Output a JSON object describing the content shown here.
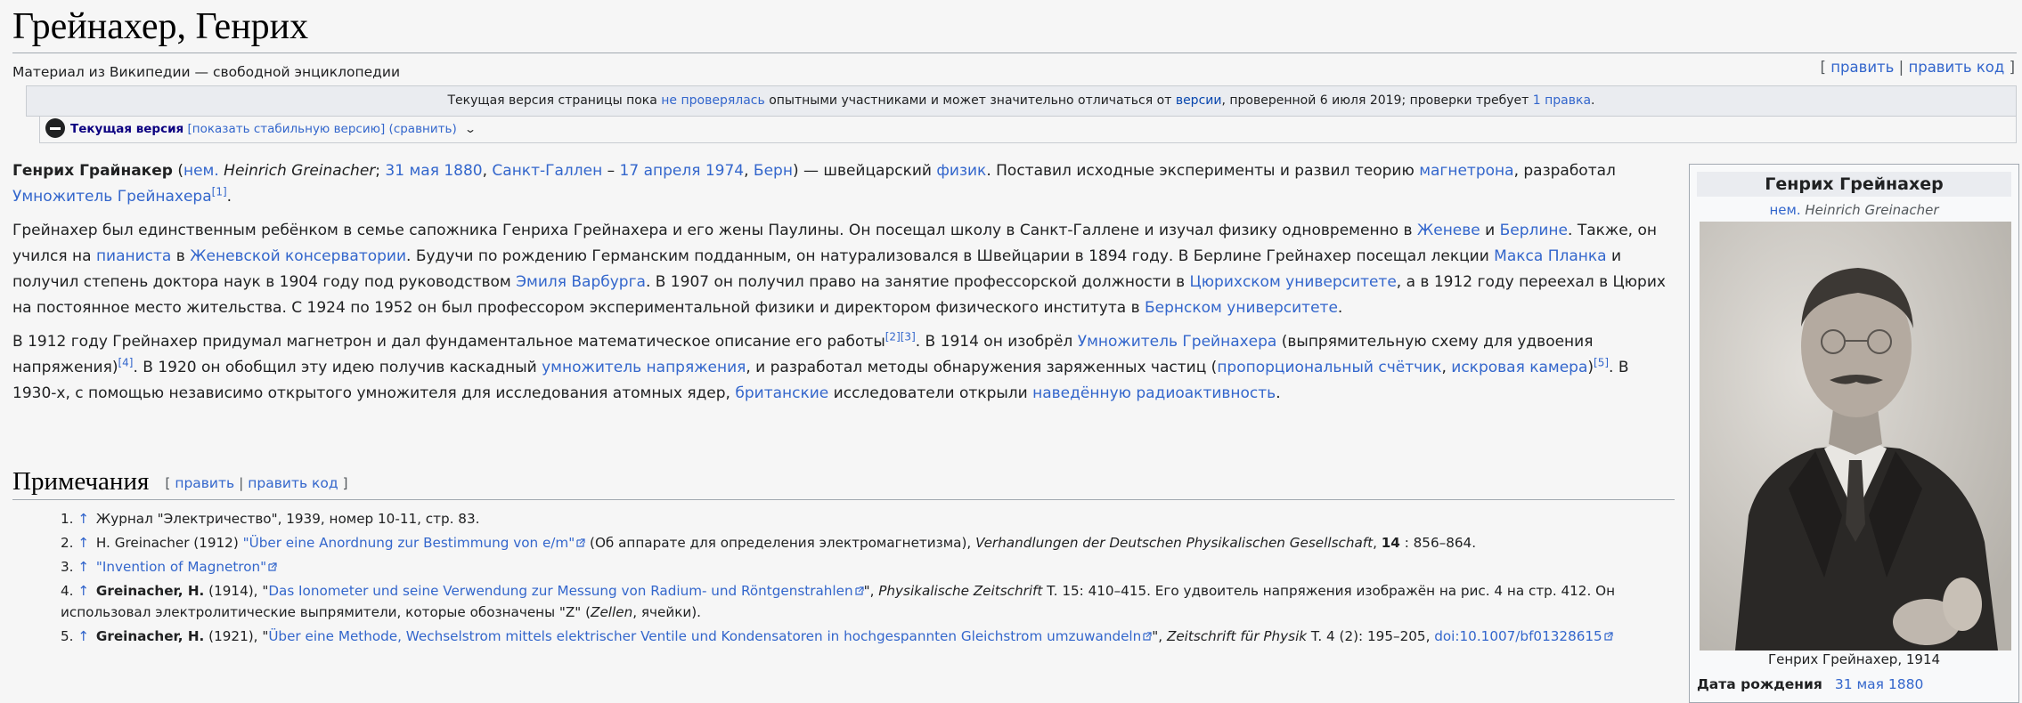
{
  "title": "Грейнахер, Генрих",
  "subtitle": "Материал из Википедии — свободной энциклопедии",
  "edit_top": {
    "open": "[",
    "edit": "править",
    "sep": "|",
    "edit_code": "править код",
    "close": "]"
  },
  "notice": {
    "t1": "Текущая версия страницы пока ",
    "l1": "не проверялась",
    "t2": " опытными участниками и может значительно отличаться от ",
    "l2": "версии",
    "t3": ", проверенной 6 июля 2019; проверки требует ",
    "l3": "1 правка",
    "t4": "."
  },
  "revbar": {
    "current": "Текущая версия",
    "show_stable": "[показать стабильную версию]",
    "compare": "(сравнить)"
  },
  "article": {
    "p1": {
      "name": "Генрих Грайнакер",
      "t1": " (",
      "lang": "нем.",
      "orig": " Heinrich Greinacher",
      "t2": "; ",
      "birth": "31 мая 1880",
      "t3": ", ",
      "birthplace": "Санкт-Галлен",
      "t4": " – ",
      "death": "17 апреля 1974",
      "t5": ", ",
      "deathplace": "Берн",
      "t6": ") — швейцарский ",
      "physicist": "физик",
      "t7": ". Поставил исходные эксперименты и развил теорию ",
      "magnetron": "магнетрона",
      "t8": ", разработал ",
      "multiplier": "Умножитель Грейнахера",
      "ref1": "[1]",
      "t9": "."
    },
    "p2": {
      "t1": "Грейнахер был единственным ребёнком в семье сапожника Генриха Грейнахера и его жены Паулины. Он посещал школу в Санкт-Галлене и изучал физику одновременно в ",
      "geneva": "Женеве",
      "t2": " и ",
      "berlin": "Берлине",
      "t3": ". Также, он учился на ",
      "pianist": "пианиста",
      "t4": " в ",
      "conservatory": "Женевской консерватории",
      "t5": ". Будучи по рождению Германским подданным, он натурализовался в Швейцарии в 1894 году. В Берлине Грейнахер посещал лекции ",
      "planck": "Макса Планка",
      "t6": " и получил степень доктора наук в 1904 году под руководством ",
      "warburg": "Эмиля Варбурга",
      "t7": ". В 1907 он получил право на занятие профессорской должности в ",
      "zurich": "Цюрихском университете",
      "t8": ", а в 1912 году переехал в Цюрих на постоянное место жительства. С 1924 по 1952 он был профессором экспериментальной физики и директором физического института в ",
      "bern": "Бернском университете",
      "t9": "."
    },
    "p3": {
      "t1": "В 1912 году Грейнахер придумал магнетрон и дал фундаментальное математическое описание его работы",
      "ref2": "[2]",
      "ref3": "[3]",
      "t2": ". В 1914 он изобрёл ",
      "multiplier": "Умножитель Грейнахера",
      "t3": " (выпрямительную схему для удвоения напряжения)",
      "ref4": "[4]",
      "t4": ". В 1920 он обобщил эту идею получив каскадный ",
      "vmult": "умножитель напряжения",
      "t5": ", и разработал методы обнаружения заряженных частиц (",
      "counter": "пропорциональный счётчик",
      "t6": ", ",
      "chamber": "искровая камера",
      "t7": ")",
      "ref5": "[5]",
      "t8": ". В 1930-х, с помощью независимо открытого умножителя для исследования атомных ядер, ",
      "british": "британские",
      "t9": " исследователи открыли ",
      "induced": "наведённую радиоактивность",
      "t10": "."
    }
  },
  "notes_heading": {
    "title": "Примечания",
    "open": "[",
    "edit": "править",
    "sep": "|",
    "edit_code": "править код",
    "close": "]"
  },
  "refs": [
    {
      "num": "1.",
      "up": "↑",
      "text": " Журнал \"Электричество\", 1939, номер 10-11, стр. 83."
    },
    {
      "num": "2.",
      "up": "↑",
      "pre": " H. Greinacher (1912) ",
      "link": "\"Über eine Anordnung zur Bestimmung von e/m\"",
      "mid": " (Об аппарате для определения электромагнетизма), ",
      "ital": "Verhandlungen der Deutschen Physikalischen Gesellschaft",
      "mid2": ", ",
      "bold": "14",
      "post": " : 856–864."
    },
    {
      "num": "3.",
      "up": "↑",
      "link": "\"Invention of Magnetron\""
    },
    {
      "num": "4.",
      "up": "↑",
      "bold": "Greinacher, H.",
      "pre": " (1914), \"",
      "link": "Das Ionometer und seine Verwendung zur Messung von Radium- und Röntgenstrahlen",
      "mid": "\", ",
      "ital": "Physikalische Zeitschrift",
      "post": " T. 15: 410–415. Его удвоитель напряжения изображён на рис. 4 на стр. 412. Он использовал электролитические выпрямители, которые обозначены \"Z\" (",
      "ital2": "Zellen",
      "post2": ", ячейки)."
    },
    {
      "num": "5.",
      "up": "↑",
      "bold": "Greinacher, H.",
      "pre": " (1921), \"",
      "link": "Über eine Methode, Wechselstrom mittels elektrischer Ventile und Kondensatoren in hochgespannten Gleichstrom umzuwandeln",
      "mid": "\", ",
      "ital": "Zeitschrift für Physik",
      "post": " T. 4 (2): 195–205, ",
      "doi": "doi:10.1007/bf01328615"
    }
  ],
  "infobox": {
    "title": "Генрих Грейнахер",
    "lang": "нем.",
    "orig": "Heinrich Greinacher",
    "caption": "Генрих Грейнахер, 1914",
    "birth_label": "Дата рождения",
    "birth_value": "31 мая 1880"
  }
}
